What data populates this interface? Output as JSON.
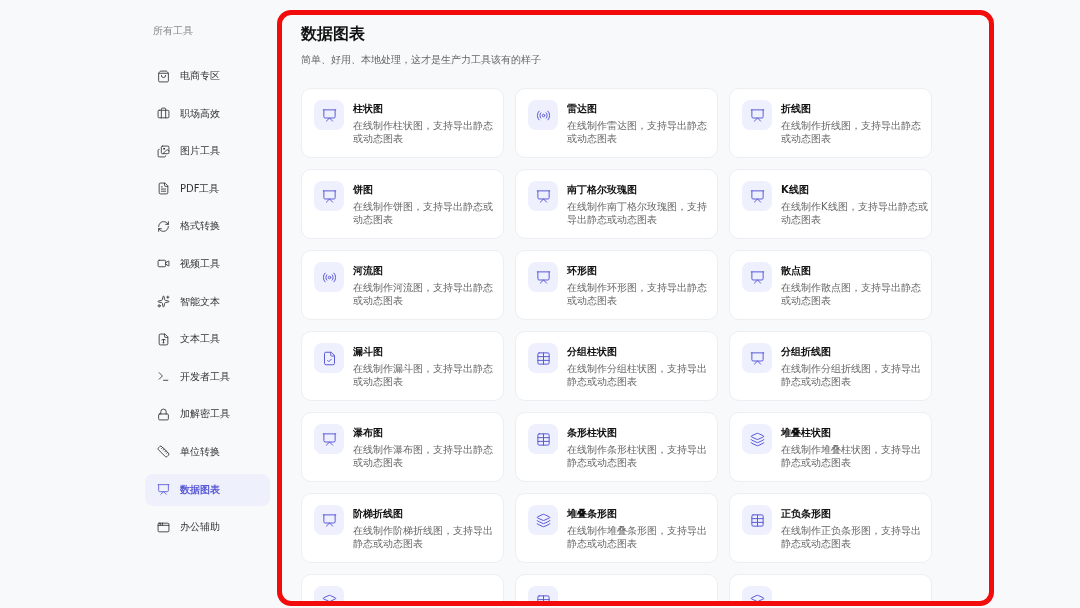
{
  "sidebar": {
    "heading": "所有工具",
    "items": [
      {
        "label": "电商专区",
        "kind": "bag",
        "selected": false
      },
      {
        "label": "职场高效",
        "kind": "briefcase",
        "selected": false
      },
      {
        "label": "图片工具",
        "kind": "images",
        "selected": false
      },
      {
        "label": "PDF工具",
        "kind": "file",
        "selected": false
      },
      {
        "label": "格式转换",
        "kind": "refresh",
        "selected": false
      },
      {
        "label": "视频工具",
        "kind": "video",
        "selected": false
      },
      {
        "label": "智能文本",
        "kind": "sparkles",
        "selected": false
      },
      {
        "label": "文本工具",
        "kind": "filetype",
        "selected": false
      },
      {
        "label": "开发者工具",
        "kind": "terminal",
        "selected": false
      },
      {
        "label": "加解密工具",
        "kind": "lock",
        "selected": false
      },
      {
        "label": "单位转换",
        "kind": "ruler",
        "selected": false
      },
      {
        "label": "数据图表",
        "kind": "presentation",
        "selected": true
      },
      {
        "label": "办公辅助",
        "kind": "window",
        "selected": false
      }
    ]
  },
  "main": {
    "title": "数据图表",
    "subtitle": "简单、好用、本地处理，这才是生产力工具该有的样子",
    "cards": [
      {
        "title": "柱状图",
        "description": "在线制作柱状图，支持导出静态或动态图表",
        "kind": "presentation"
      },
      {
        "title": "雷达图",
        "description": "在线制作雷达图，支持导出静态或动态图表",
        "kind": "radio"
      },
      {
        "title": "折线图",
        "description": "在线制作折线图，支持导出静态或动态图表",
        "kind": "presentation"
      },
      {
        "title": "饼图",
        "description": "在线制作饼图，支持导出静态或动态图表",
        "kind": "presentation"
      },
      {
        "title": "南丁格尔玫瑰图",
        "description": "在线制作南丁格尔玫瑰图，支持导出静态或动态图表",
        "kind": "presentation"
      },
      {
        "title": "K线图",
        "description": "在线制作K线图，支持导出静态或动态图表",
        "kind": "presentation"
      },
      {
        "title": "河流图",
        "description": "在线制作河流图，支持导出静态或动态图表",
        "kind": "radio"
      },
      {
        "title": "环形图",
        "description": "在线制作环形图，支持导出静态或动态图表",
        "kind": "presentation"
      },
      {
        "title": "散点图",
        "description": "在线制作散点图，支持导出静态或动态图表",
        "kind": "presentation"
      },
      {
        "title": "漏斗图",
        "description": "在线制作漏斗图，支持导出静态或动态图表",
        "kind": "filecheck"
      },
      {
        "title": "分组柱状图",
        "description": "在线制作分组柱状图，支持导出静态或动态图表",
        "kind": "table"
      },
      {
        "title": "分组折线图",
        "description": "在线制作分组折线图，支持导出静态或动态图表",
        "kind": "presentation"
      },
      {
        "title": "瀑布图",
        "description": "在线制作瀑布图，支持导出静态或动态图表",
        "kind": "presentation"
      },
      {
        "title": "条形柱状图",
        "description": "在线制作条形柱状图，支持导出静态或动态图表",
        "kind": "table"
      },
      {
        "title": "堆叠柱状图",
        "description": "在线制作堆叠柱状图，支持导出静态或动态图表",
        "kind": "layers"
      },
      {
        "title": "阶梯折线图",
        "description": "在线制作阶梯折线图，支持导出静态或动态图表",
        "kind": "presentation"
      },
      {
        "title": "堆叠条形图",
        "description": "在线制作堆叠条形图，支持导出静态或动态图表",
        "kind": "layers"
      },
      {
        "title": "正负条形图",
        "description": "在线制作正负条形图，支持导出静态或动态图表",
        "kind": "table"
      },
      {
        "kind": "layers"
      },
      {
        "kind": "table"
      },
      {
        "kind": "layers"
      }
    ]
  }
}
